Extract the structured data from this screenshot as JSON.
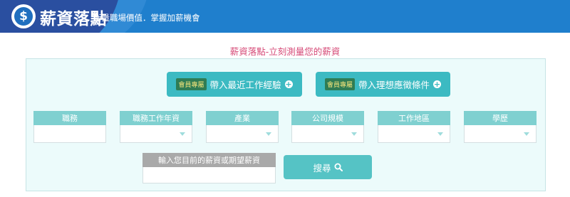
{
  "header": {
    "logo_symbol": "$",
    "title": "薪資落點",
    "tagline": "衡量職場價值．掌握加薪機會"
  },
  "page_title": "薪資落點-立刻測量您的薪資",
  "experience_buttons": [
    {
      "badge": "會員專屬",
      "label": "帶入最近工作經驗",
      "icon": "plus-circle-icon"
    },
    {
      "badge": "會員專屬",
      "label": "帶入理想應徵條件",
      "icon": "plus-circle-icon"
    }
  ],
  "fields": [
    {
      "label": "職務",
      "value": ""
    },
    {
      "label": "職務工作年資",
      "value": ""
    },
    {
      "label": "產業",
      "value": ""
    },
    {
      "label": "公司規模",
      "value": ""
    },
    {
      "label": "工作地區",
      "value": ""
    },
    {
      "label": "學歷",
      "value": ""
    }
  ],
  "salary": {
    "label": "輸入您目前的薪資或期望薪資",
    "value": ""
  },
  "search": {
    "label": "搜尋",
    "icon": "search-icon"
  },
  "colors": {
    "header_blue": "#1f7fcd",
    "accent_teal": "#3cbac2",
    "title_pink": "#d64a77",
    "badge_green": "#2f7c54"
  }
}
